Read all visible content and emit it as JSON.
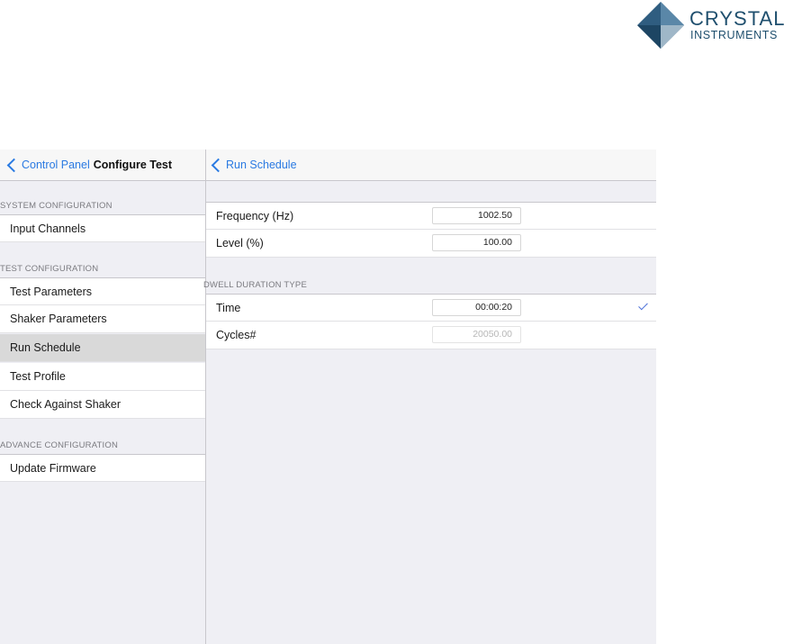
{
  "logo": {
    "word1": "CRYSTAL",
    "word2": "INSTRUMENTS"
  },
  "left": {
    "back_label": "Control Panel",
    "title": "Configure Test",
    "sections": {
      "system": "SYSTEM CONFIGURATION",
      "test": "TEST CONFIGURATION",
      "advance": "ADVANCE CONFIGURATION"
    },
    "items": {
      "input_channels": "Input Channels",
      "test_parameters": "Test Parameters",
      "shaker_parameters": "Shaker Parameters",
      "run_schedule": "Run Schedule",
      "test_profile": "Test Profile",
      "check_against_shaker": "Check Against Shaker",
      "update_firmware": "Update Firmware"
    },
    "selected": "Run Schedule"
  },
  "right": {
    "back_label": "Run Schedule",
    "frequency": {
      "label": "Frequency (Hz)",
      "value": "1002.50"
    },
    "level": {
      "label": "Level (%)",
      "value": "100.00"
    },
    "dwell_header": "DWELL DURATION TYPE",
    "time": {
      "label": "Time",
      "value": "00:00:20",
      "checked": true
    },
    "cycles": {
      "label": "Cycles#",
      "value": "20050.00"
    }
  },
  "colors": {
    "accent": "#2a7ae2",
    "logo": "#1f4f6e",
    "check": "#4a6fd8"
  },
  "icons": {
    "back": "chevron-left-icon",
    "check": "checkmark-icon",
    "logo": "diamond-logo-icon"
  }
}
